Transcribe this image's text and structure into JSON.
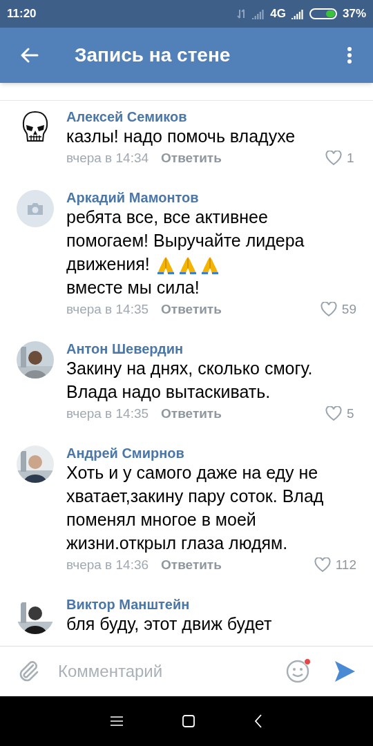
{
  "status_bar": {
    "time": "11:20",
    "network": "4G",
    "battery": {
      "text": "37%",
      "level": 0.37
    }
  },
  "app_bar": {
    "title": "Запись на стене"
  },
  "comments": [
    {
      "avatar": {
        "kind": "skull"
      },
      "author": "Алексей Семиков",
      "text": "казлы! надо помочь владухе",
      "time": "вчера в 14:34",
      "reply": "Ответить",
      "likes": "1"
    },
    {
      "avatar": {
        "kind": "camera"
      },
      "author": "Аркадий Мамонтов",
      "text": "ребята все, все активнее помогаем! Выручайте лидера движения!",
      "emoji": [
        {
          "kind": "praying-hands"
        },
        {
          "kind": "praying-hands"
        },
        {
          "kind": "praying-hands"
        }
      ],
      "text_after": "вместе мы сила!",
      "time": "вчера в 14:35",
      "reply": "Ответить",
      "likes": "59"
    },
    {
      "author": "Антон Шевердин",
      "text": "Закину на днях, сколько смогу. Влада надо вытаскивать.",
      "time": "вчера в 14:35",
      "reply": "Ответить",
      "likes": "5"
    },
    {
      "author": "Андрей Смирнов",
      "text": "Хоть и у самого даже на еду не хватает,закину пару соток. Влад поменял многое в моей жизни.открыл глаза людям.",
      "time": "вчера в 14:36",
      "reply": "Ответить",
      "likes": "112"
    },
    {
      "author": "Виктор Манштейн",
      "text": "бля буду, этот движ будет"
    }
  ],
  "composer": {
    "placeholder": "Комментарий",
    "emoji_notification": true
  }
}
